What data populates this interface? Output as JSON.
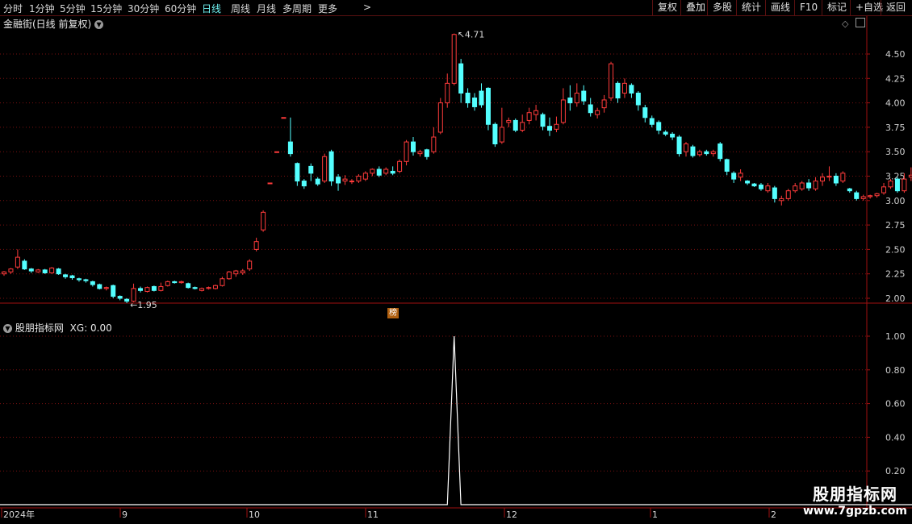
{
  "toolbar": {
    "periods": [
      "分时",
      "1分钟",
      "5分钟",
      "15分钟",
      "30分钟",
      "60分钟",
      "日线",
      "周线",
      "月线",
      "多周期",
      "更多"
    ],
    "active_period": "日线",
    "more_arrow": ">",
    "buttons": [
      "复权",
      "叠加",
      "多股",
      "统计",
      "画线",
      "F10",
      "标记",
      "+自选",
      "返回"
    ]
  },
  "main_chart": {
    "title": "金融街(日线 前复权)",
    "y_ticks": [
      "4.50",
      "4.25",
      "4.00",
      "3.75",
      "3.50",
      "3.25",
      "3.00",
      "2.75",
      "2.50",
      "2.25",
      "2.00"
    ],
    "high_label": "4.71",
    "low_label": "1.95",
    "rank_badge": "榜",
    "colors": {
      "up": "#ff3b3b",
      "down": "#54ffff",
      "grid": "#7a1010",
      "axis": "#a01010"
    }
  },
  "indicator": {
    "name": "股朋指标网",
    "value_label": "XG: 0.00",
    "y_ticks": [
      "1.00",
      "0.80",
      "0.60",
      "0.40",
      "0.20"
    ],
    "line_color": "#ffffff"
  },
  "x_axis": {
    "labels": [
      "2024年",
      "9",
      "10",
      "11",
      "12",
      "1",
      "2"
    ]
  },
  "watermark": {
    "title": "股朋指标网",
    "url": "www.7gpzb.com"
  },
  "chart_data": {
    "type": "candlestick",
    "price_range": [
      1.85,
      4.75
    ],
    "candles": [
      [
        2.25,
        2.27,
        2.23,
        2.28
      ],
      [
        2.27,
        2.3,
        2.25,
        2.31
      ],
      [
        2.32,
        2.42,
        2.3,
        2.5
      ],
      [
        2.38,
        2.3,
        2.29,
        2.4
      ],
      [
        2.3,
        2.28,
        2.26,
        2.31
      ],
      [
        2.27,
        2.29,
        2.26,
        2.3
      ],
      [
        2.29,
        2.26,
        2.25,
        2.3
      ],
      [
        2.26,
        2.31,
        2.25,
        2.32
      ],
      [
        2.3,
        2.25,
        2.24,
        2.31
      ],
      [
        2.24,
        2.22,
        2.2,
        2.25
      ],
      [
        2.23,
        2.21,
        2.19,
        2.24
      ],
      [
        2.2,
        2.19,
        2.17,
        2.21
      ],
      [
        2.19,
        2.18,
        2.16,
        2.2
      ],
      [
        2.17,
        2.14,
        2.12,
        2.18
      ],
      [
        2.14,
        2.1,
        2.09,
        2.15
      ],
      [
        2.1,
        2.11,
        2.08,
        2.12
      ],
      [
        2.13,
        2.02,
        2.0,
        2.14
      ],
      [
        2.02,
        2.0,
        1.98,
        2.03
      ],
      [
        1.99,
        1.97,
        1.95,
        2.0
      ],
      [
        1.97,
        2.1,
        1.96,
        2.15
      ],
      [
        2.1,
        2.08,
        2.06,
        2.12
      ],
      [
        2.07,
        2.11,
        2.06,
        2.12
      ],
      [
        2.12,
        2.08,
        2.07,
        2.13
      ],
      [
        2.08,
        2.12,
        2.07,
        2.16
      ],
      [
        2.13,
        2.17,
        2.12,
        2.18
      ],
      [
        2.17,
        2.16,
        2.15,
        2.18
      ],
      [
        2.16,
        2.17,
        2.15,
        2.18
      ],
      [
        2.15,
        2.11,
        2.1,
        2.16
      ],
      [
        2.11,
        2.1,
        2.09,
        2.12
      ],
      [
        2.08,
        2.1,
        2.07,
        2.11
      ],
      [
        2.1,
        2.11,
        2.09,
        2.12
      ],
      [
        2.1,
        2.13,
        2.09,
        2.14
      ],
      [
        2.13,
        2.2,
        2.12,
        2.22
      ],
      [
        2.2,
        2.27,
        2.19,
        2.28
      ],
      [
        2.25,
        2.28,
        2.22,
        2.29
      ],
      [
        2.26,
        2.28,
        2.24,
        2.3
      ],
      [
        2.3,
        2.38,
        2.28,
        2.4
      ],
      [
        2.5,
        2.58,
        2.48,
        2.62
      ],
      [
        2.7,
        2.88,
        2.68,
        2.9
      ],
      [
        3.18,
        3.18,
        3.18,
        3.18
      ],
      [
        3.5,
        3.5,
        3.5,
        3.5
      ],
      [
        3.85,
        3.85,
        3.85,
        3.85
      ],
      [
        3.6,
        3.48,
        3.45,
        3.85
      ],
      [
        3.38,
        3.2,
        3.15,
        3.39
      ],
      [
        3.2,
        3.15,
        3.12,
        3.22
      ],
      [
        3.35,
        3.28,
        3.2,
        3.38
      ],
      [
        3.22,
        3.17,
        3.15,
        3.24
      ],
      [
        3.2,
        3.45,
        3.18,
        3.48
      ],
      [
        3.5,
        3.2,
        3.15,
        3.52
      ],
      [
        3.24,
        3.18,
        3.1,
        3.27
      ],
      [
        3.2,
        3.22,
        3.16,
        3.26
      ],
      [
        3.2,
        3.2,
        3.17,
        3.22
      ],
      [
        3.2,
        3.25,
        3.18,
        3.27
      ],
      [
        3.22,
        3.28,
        3.2,
        3.3
      ],
      [
        3.28,
        3.32,
        3.25,
        3.33
      ],
      [
        3.32,
        3.26,
        3.24,
        3.35
      ],
      [
        3.28,
        3.32,
        3.26,
        3.34
      ],
      [
        3.3,
        3.28,
        3.26,
        3.35
      ],
      [
        3.3,
        3.4,
        3.28,
        3.42
      ],
      [
        3.4,
        3.6,
        3.36,
        3.62
      ],
      [
        3.6,
        3.5,
        3.46,
        3.65
      ],
      [
        3.48,
        3.5,
        3.45,
        3.52
      ],
      [
        3.52,
        3.45,
        3.42,
        3.53
      ],
      [
        3.5,
        3.65,
        3.48,
        3.75
      ],
      [
        3.7,
        4.0,
        3.68,
        4.05
      ],
      [
        4.0,
        4.2,
        3.95,
        4.3
      ],
      [
        4.2,
        4.7,
        4.18,
        4.71
      ],
      [
        4.4,
        4.1,
        4.0,
        4.45
      ],
      [
        4.1,
        4.0,
        3.95,
        4.15
      ],
      [
        4.05,
        3.96,
        3.92,
        4.1
      ],
      [
        4.12,
        3.98,
        3.95,
        4.2
      ],
      [
        4.15,
        3.78,
        3.72,
        4.16
      ],
      [
        3.78,
        3.58,
        3.55,
        3.8
      ],
      [
        3.6,
        3.75,
        3.58,
        3.95
      ],
      [
        3.8,
        3.82,
        3.75,
        3.85
      ],
      [
        3.82,
        3.72,
        3.7,
        3.84
      ],
      [
        3.72,
        3.8,
        3.7,
        3.88
      ],
      [
        3.82,
        3.9,
        3.78,
        3.95
      ],
      [
        3.88,
        3.92,
        3.82,
        3.98
      ],
      [
        3.88,
        3.76,
        3.72,
        3.9
      ],
      [
        3.76,
        3.72,
        3.66,
        3.85
      ],
      [
        3.73,
        3.78,
        3.7,
        3.86
      ],
      [
        3.8,
        4.03,
        3.78,
        4.15
      ],
      [
        4.05,
        4.0,
        3.92,
        4.18
      ],
      [
        4.0,
        4.1,
        3.96,
        4.2
      ],
      [
        4.12,
        4.02,
        3.98,
        4.18
      ],
      [
        3.98,
        3.9,
        3.86,
        4.05
      ],
      [
        3.88,
        3.92,
        3.84,
        3.95
      ],
      [
        3.95,
        4.03,
        3.9,
        4.08
      ],
      [
        4.05,
        4.4,
        4.02,
        4.42
      ],
      [
        4.2,
        4.05,
        4.0,
        4.22
      ],
      [
        4.1,
        4.2,
        4.05,
        4.25
      ],
      [
        4.18,
        4.1,
        4.05,
        4.2
      ],
      [
        4.1,
        3.98,
        3.92,
        4.12
      ],
      [
        3.95,
        3.85,
        3.8,
        3.98
      ],
      [
        3.84,
        3.78,
        3.75,
        3.87
      ],
      [
        3.8,
        3.72,
        3.68,
        3.82
      ],
      [
        3.7,
        3.68,
        3.66,
        3.72
      ],
      [
        3.68,
        3.65,
        3.62,
        3.7
      ],
      [
        3.65,
        3.48,
        3.45,
        3.67
      ],
      [
        3.5,
        3.58,
        3.45,
        3.6
      ],
      [
        3.55,
        3.46,
        3.44,
        3.57
      ],
      [
        3.47,
        3.5,
        3.45,
        3.52
      ],
      [
        3.5,
        3.48,
        3.46,
        3.52
      ],
      [
        3.48,
        3.5,
        3.45,
        3.52
      ],
      [
        3.58,
        3.43,
        3.4,
        3.6
      ],
      [
        3.42,
        3.3,
        3.26,
        3.43
      ],
      [
        3.28,
        3.22,
        3.18,
        3.3
      ],
      [
        3.24,
        3.28,
        3.2,
        3.32
      ],
      [
        3.2,
        3.18,
        3.16,
        3.21
      ],
      [
        3.17,
        3.15,
        3.14,
        3.18
      ],
      [
        3.16,
        3.12,
        3.1,
        3.18
      ],
      [
        3.1,
        3.15,
        3.08,
        3.18
      ],
      [
        3.13,
        3.02,
        2.98,
        3.15
      ],
      [
        3.0,
        3.02,
        2.95,
        3.05
      ],
      [
        3.02,
        3.1,
        3.0,
        3.12
      ],
      [
        3.1,
        3.15,
        3.08,
        3.18
      ],
      [
        3.12,
        3.18,
        3.1,
        3.2
      ],
      [
        3.18,
        3.13,
        3.1,
        3.22
      ],
      [
        3.12,
        3.2,
        3.1,
        3.24
      ],
      [
        3.2,
        3.24,
        3.15,
        3.28
      ],
      [
        3.24,
        3.25,
        3.2,
        3.35
      ],
      [
        3.25,
        3.18,
        3.15,
        3.28
      ],
      [
        3.2,
        3.28,
        3.18,
        3.3
      ],
      [
        3.12,
        3.1,
        3.08,
        3.13
      ],
      [
        3.08,
        3.02,
        3.0,
        3.1
      ],
      [
        3.02,
        3.04,
        3.0,
        3.06
      ],
      [
        3.04,
        3.05,
        3.02,
        3.06
      ],
      [
        3.05,
        3.07,
        3.03,
        3.08
      ],
      [
        3.08,
        3.14,
        3.06,
        3.18
      ],
      [
        3.14,
        3.2,
        3.12,
        3.22
      ],
      [
        3.22,
        3.1,
        3.08,
        3.24
      ],
      [
        3.1,
        3.22,
        3.08,
        3.28
      ],
      [
        3.24,
        3.26,
        3.2,
        3.34
      ],
      [
        3.3,
        3.16,
        3.12,
        3.32
      ],
      [
        3.18,
        3.2,
        3.14,
        3.24
      ],
      [
        3.2,
        3.12,
        3.1,
        3.22
      ],
      [
        3.1,
        3.1,
        3.08,
        3.12
      ],
      [
        3.1,
        3.12,
        3.08,
        3.2
      ],
      [
        3.14,
        3.08,
        3.06,
        3.16
      ],
      [
        3.08,
        3.12,
        3.06,
        3.2
      ],
      [
        3.12,
        3.11,
        3.09,
        3.14
      ],
      [
        3.12,
        3.1,
        3.08,
        3.14
      ]
    ],
    "indicator_series": {
      "name": "XG",
      "values_by_candle": "0 everywhere except candle index 66 which is 1.00",
      "spike_index": 66,
      "ylim": [
        0,
        1.05
      ]
    }
  }
}
